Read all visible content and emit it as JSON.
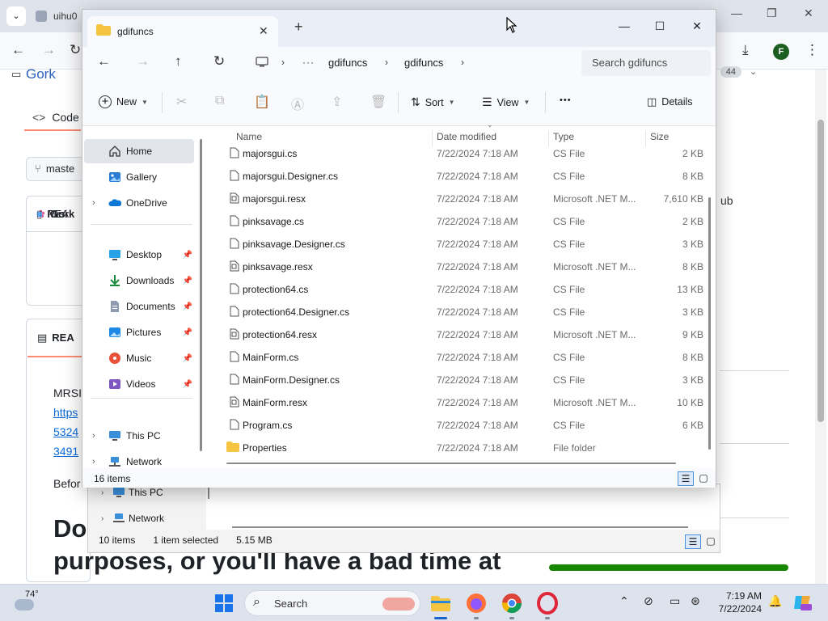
{
  "browser": {
    "tab_title": "uihu0",
    "profile_initial": "F",
    "github": {
      "repo_title": "Gork",
      "code_tab": "Code",
      "branch": "maste",
      "file_rows": [
        "Gork",
        "Mrsi",
        "REA"
      ],
      "readme_tab": "REA",
      "stars_label": "ar",
      "stars_count": "44",
      "right_text": "ub",
      "text_mrsi": "MRSI",
      "link_lines": [
        "https",
        "5324",
        "3491"
      ],
      "text_before": "Befor",
      "heading_line1": "Do",
      "heading_line2": "purposes, or you'll have a bad time at",
      "lang_bar_color": "#178600"
    }
  },
  "explorer_back": {
    "nav_items": [
      {
        "label": "This PC",
        "icon": "pc-icon"
      },
      {
        "label": "Network",
        "icon": "network-icon"
      }
    ],
    "status_items": "10 items",
    "status_selected": "1 item selected",
    "status_size": "5.15 MB"
  },
  "explorer": {
    "tab_title": "gdifuncs",
    "search_placeholder": "Search gdifuncs",
    "breadcrumb": [
      "gdifuncs",
      "gdifuncs"
    ],
    "commands": {
      "new": "New",
      "sort": "Sort",
      "view": "View",
      "more": "•••",
      "details": "Details"
    },
    "sidebar": [
      {
        "label": "Home",
        "icon": "home-icon",
        "selected": true,
        "chevron": false,
        "pinned": false
      },
      {
        "label": "Gallery",
        "icon": "gallery-icon",
        "selected": false,
        "chevron": false,
        "pinned": false
      },
      {
        "label": "OneDrive",
        "icon": "onedrive-icon",
        "selected": false,
        "chevron": true,
        "pinned": false
      },
      {
        "label": "Desktop",
        "icon": "desktop-icon",
        "selected": false,
        "chevron": false,
        "pinned": true
      },
      {
        "label": "Downloads",
        "icon": "downloads-icon",
        "selected": false,
        "chevron": false,
        "pinned": true
      },
      {
        "label": "Documents",
        "icon": "documents-icon",
        "selected": false,
        "chevron": false,
        "pinned": true
      },
      {
        "label": "Pictures",
        "icon": "pictures-icon",
        "selected": false,
        "chevron": false,
        "pinned": true
      },
      {
        "label": "Music",
        "icon": "music-icon",
        "selected": false,
        "chevron": false,
        "pinned": true
      },
      {
        "label": "Videos",
        "icon": "videos-icon",
        "selected": false,
        "chevron": false,
        "pinned": true
      },
      {
        "label": "This PC",
        "icon": "pc-icon",
        "selected": false,
        "chevron": true,
        "pinned": false
      },
      {
        "label": "Network",
        "icon": "network-icon",
        "selected": false,
        "chevron": true,
        "pinned": false
      }
    ],
    "columns": {
      "name": "Name",
      "date": "Date modified",
      "type": "Type",
      "size": "Size"
    },
    "files": [
      {
        "name": "majorsgui.cs",
        "date": "7/22/2024 7:18 AM",
        "type": "CS File",
        "size": "2 KB",
        "kind": "file"
      },
      {
        "name": "majorsgui.Designer.cs",
        "date": "7/22/2024 7:18 AM",
        "type": "CS File",
        "size": "8 KB",
        "kind": "file"
      },
      {
        "name": "majorsgui.resx",
        "date": "7/22/2024 7:18 AM",
        "type": "Microsoft .NET M...",
        "size": "7,610 KB",
        "kind": "resx"
      },
      {
        "name": "pinksavage.cs",
        "date": "7/22/2024 7:18 AM",
        "type": "CS File",
        "size": "2 KB",
        "kind": "file"
      },
      {
        "name": "pinksavage.Designer.cs",
        "date": "7/22/2024 7:18 AM",
        "type": "CS File",
        "size": "3 KB",
        "kind": "file"
      },
      {
        "name": "pinksavage.resx",
        "date": "7/22/2024 7:18 AM",
        "type": "Microsoft .NET M...",
        "size": "8 KB",
        "kind": "resx"
      },
      {
        "name": "protection64.cs",
        "date": "7/22/2024 7:18 AM",
        "type": "CS File",
        "size": "13 KB",
        "kind": "file"
      },
      {
        "name": "protection64.Designer.cs",
        "date": "7/22/2024 7:18 AM",
        "type": "CS File",
        "size": "3 KB",
        "kind": "file"
      },
      {
        "name": "protection64.resx",
        "date": "7/22/2024 7:18 AM",
        "type": "Microsoft .NET M...",
        "size": "9 KB",
        "kind": "resx"
      },
      {
        "name": "MainForm.cs",
        "date": "7/22/2024 7:18 AM",
        "type": "CS File",
        "size": "8 KB",
        "kind": "file"
      },
      {
        "name": "MainForm.Designer.cs",
        "date": "7/22/2024 7:18 AM",
        "type": "CS File",
        "size": "3 KB",
        "kind": "file"
      },
      {
        "name": "MainForm.resx",
        "date": "7/22/2024 7:18 AM",
        "type": "Microsoft .NET M...",
        "size": "10 KB",
        "kind": "resx"
      },
      {
        "name": "Program.cs",
        "date": "7/22/2024 7:18 AM",
        "type": "CS File",
        "size": "6 KB",
        "kind": "file"
      },
      {
        "name": "Properties",
        "date": "7/22/2024 7:18 AM",
        "type": "File folder",
        "size": "",
        "kind": "folder"
      }
    ],
    "status": "16 items"
  },
  "taskbar": {
    "temperature": "74°",
    "search_label": "Search",
    "time": "7:19 AM",
    "date": "7/22/2024",
    "apps": [
      "file-explorer-icon",
      "firefox-icon",
      "chrome-icon",
      "opera-icon"
    ]
  }
}
